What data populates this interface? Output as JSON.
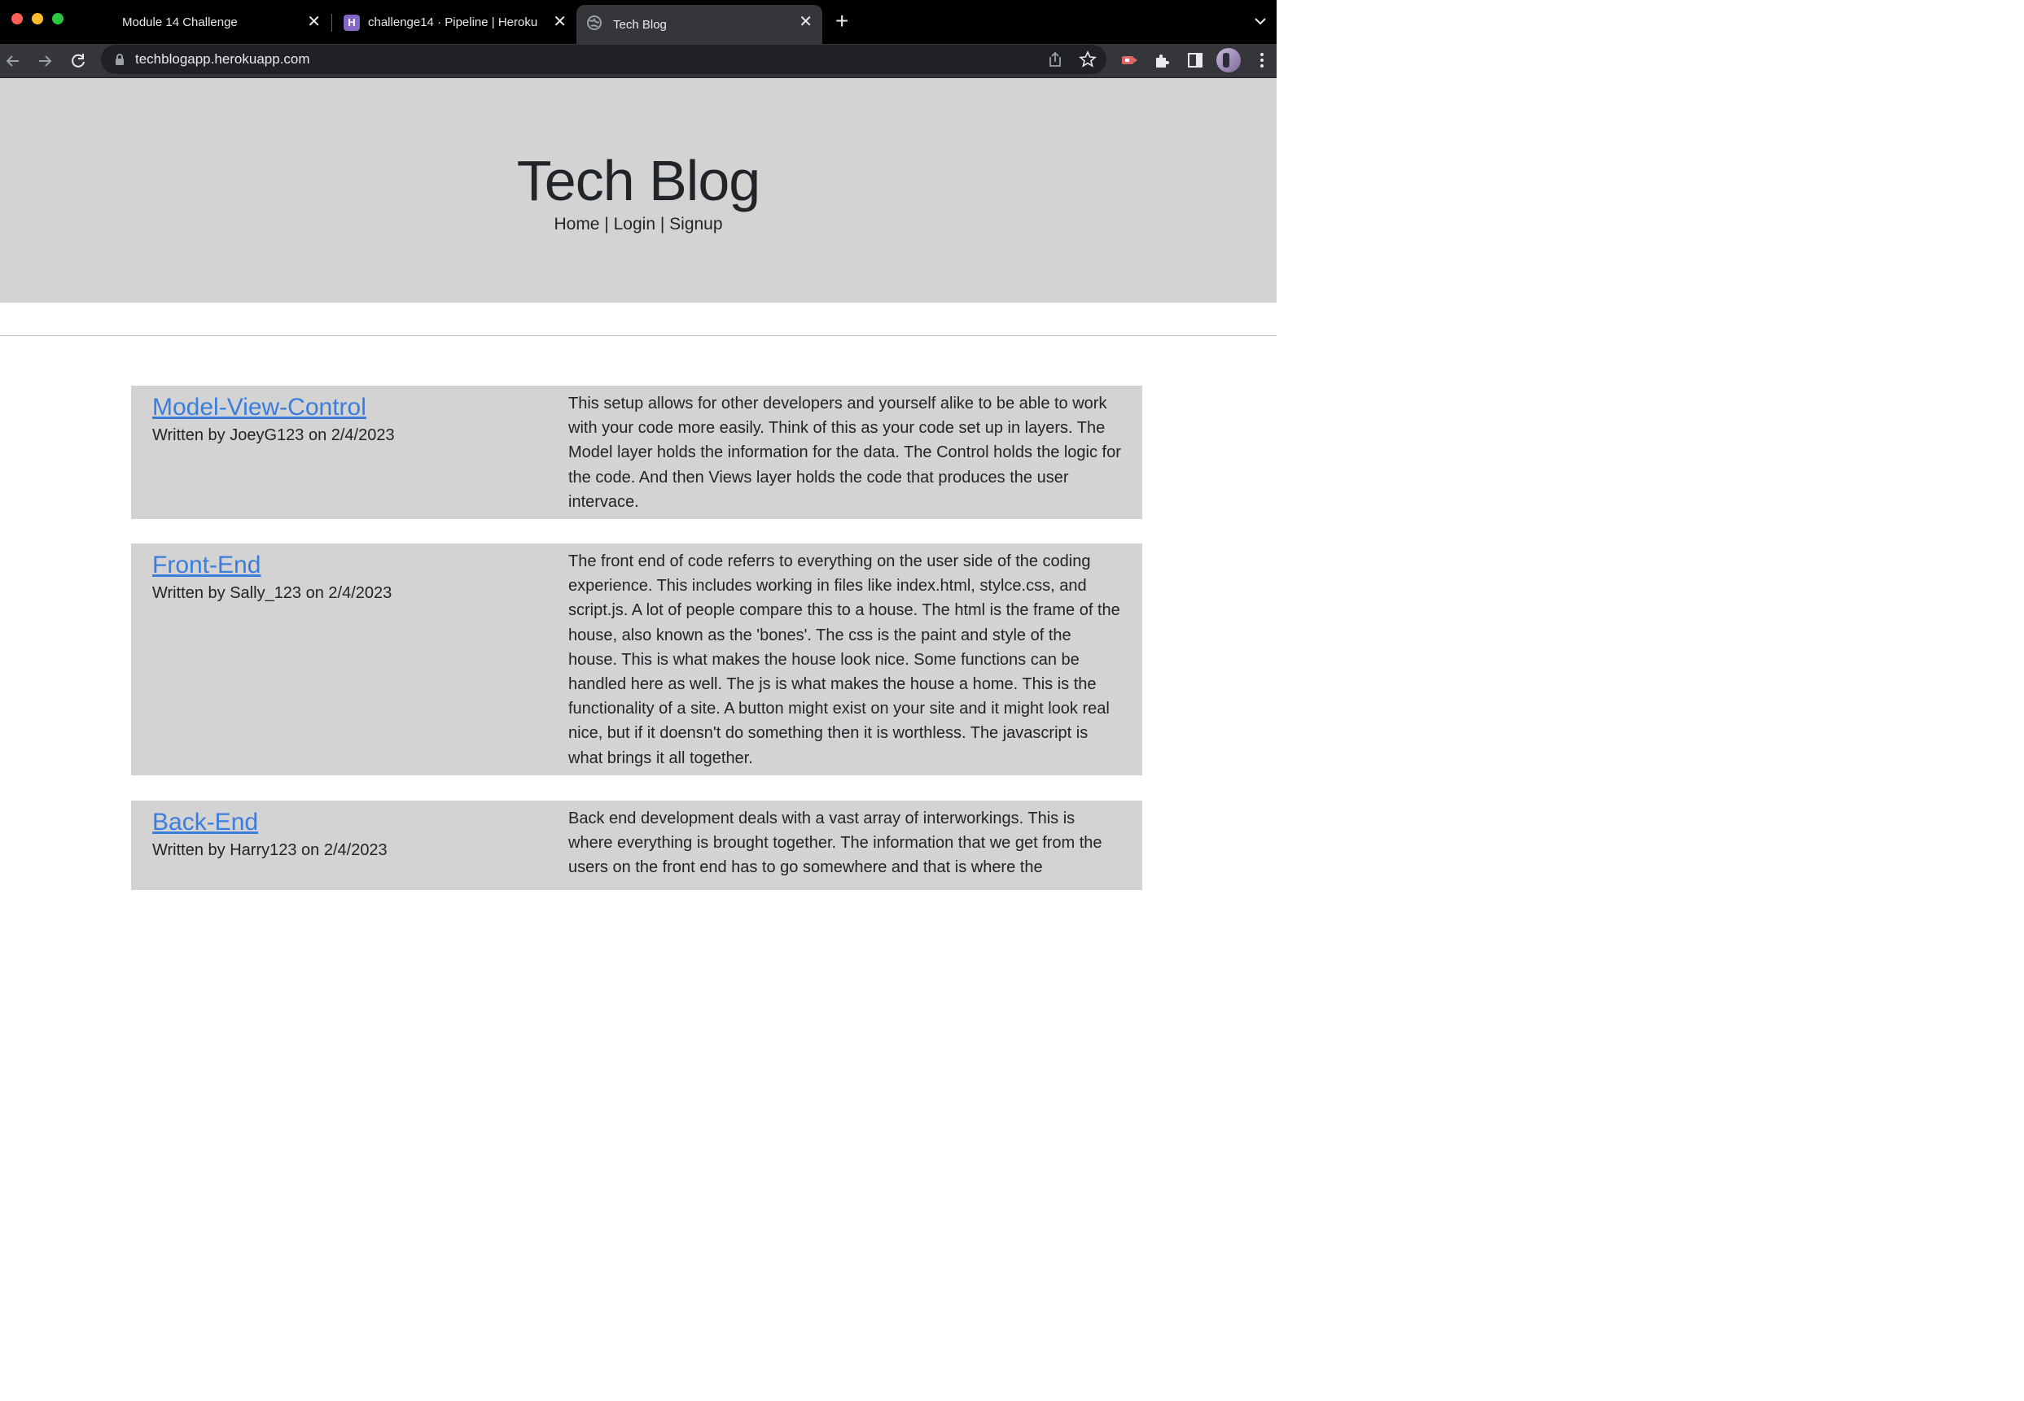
{
  "browser": {
    "tabs": [
      {
        "title": "Module 14 Challenge"
      },
      {
        "title": "challenge14 · Pipeline | Heroku"
      },
      {
        "title": "Tech Blog"
      }
    ],
    "url": "techblogapp.herokuapp.com"
  },
  "header": {
    "title": "Tech Blog",
    "nav": {
      "home": "Home",
      "sep1": " | ",
      "login": "Login",
      "sep2": " | ",
      "signup": "Signup"
    }
  },
  "posts": [
    {
      "title": "Model-View-Control",
      "meta": "Written by JoeyG123 on 2/4/2023",
      "body": "This setup allows for other developers and yourself alike to be able to work with your code more easily. Think of this as your code set up in layers. The Model layer holds the information for the data. The Control holds the logic for the code. And then Views layer holds the code that produces the user intervace."
    },
    {
      "title": "Front-End",
      "meta": "Written by Sally_123 on 2/4/2023",
      "body": "The front end of code referrs to everything on the user side of the coding experience. This includes working in files like index.html, stylce.css, and script.js. A lot of people compare this to a house. The html is the frame of the house, also known as the 'bones'. The css is the paint and style of the house. This is what makes the house look nice. Some functions can be handled here as well. The js is what makes the house a home. This is the functionality of a site. A button might exist on your site and it might look real nice, but if it doensn't do something then it is worthless. The javascript is what brings it all together."
    },
    {
      "title": "Back-End",
      "meta": "Written by Harry123 on 2/4/2023",
      "body": "Back end development deals with a vast array of interworkings. This is where everything is brought together. The information that we get from the users on the front end has to go somewhere and that is where the"
    }
  ]
}
